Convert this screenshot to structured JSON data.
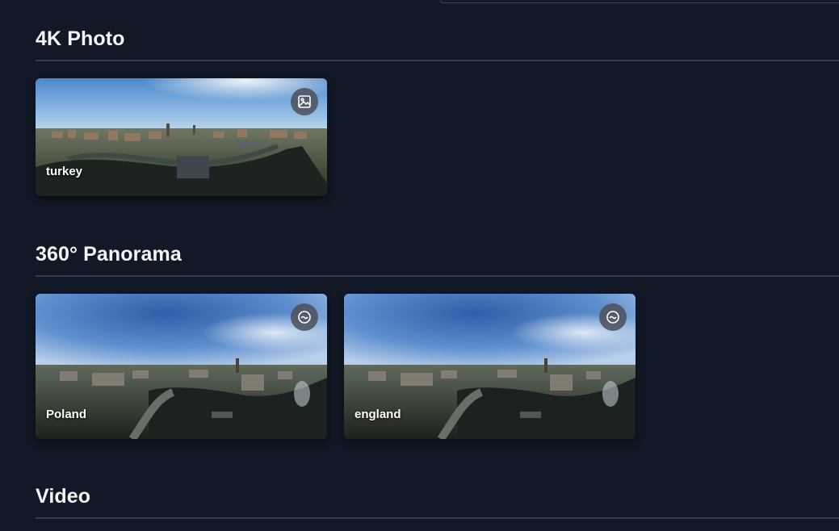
{
  "sections": [
    {
      "title": "4K Photo",
      "items": [
        {
          "label": "turkey",
          "badge_icon": "image-icon"
        }
      ]
    },
    {
      "title": "360° Panorama",
      "items": [
        {
          "label": "Poland",
          "badge_icon": "panorama-icon"
        },
        {
          "label": "england",
          "badge_icon": "panorama-icon"
        }
      ]
    },
    {
      "title": "Video",
      "items": []
    }
  ],
  "colors": {
    "background": "#121826",
    "divider": "#343b4b",
    "badge": "#4b505a",
    "text": "#f3f4f6"
  }
}
